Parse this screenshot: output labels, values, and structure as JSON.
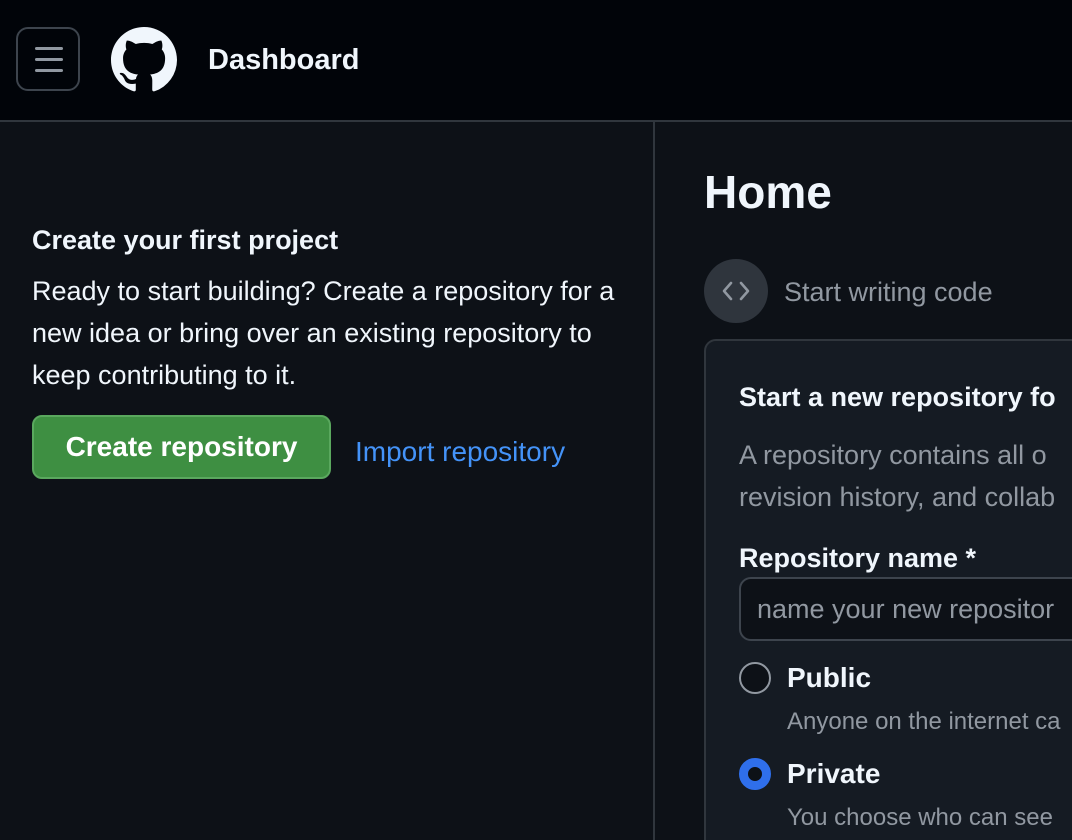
{
  "header": {
    "title": "Dashboard"
  },
  "left_panel": {
    "title": "Create your first project",
    "description": "Ready to start building? Create a repository for a new idea or bring over an existing repository to keep contributing to it.",
    "create_button": "Create repository",
    "import_link": "Import repository"
  },
  "main": {
    "title": "Home",
    "start_writing": "Start writing code",
    "card": {
      "title": "Start a new repository fo",
      "description_line1": "A repository contains all o",
      "description_line2": "revision history, and collab",
      "repo_name_label": "Repository name *",
      "repo_name_placeholder": "name your new repositor",
      "visibility": [
        {
          "label": "Public",
          "description": "Anyone on the internet ca",
          "selected": false
        },
        {
          "label": "Private",
          "description": "You choose who can see",
          "selected": true
        }
      ]
    }
  },
  "colors": {
    "accent_green": "#3e8f42",
    "link_blue": "#4493f8",
    "radio_blue": "#2f6feb"
  },
  "icons": [
    "hamburger-menu-icon",
    "github-logo-icon",
    "code-icon"
  ]
}
